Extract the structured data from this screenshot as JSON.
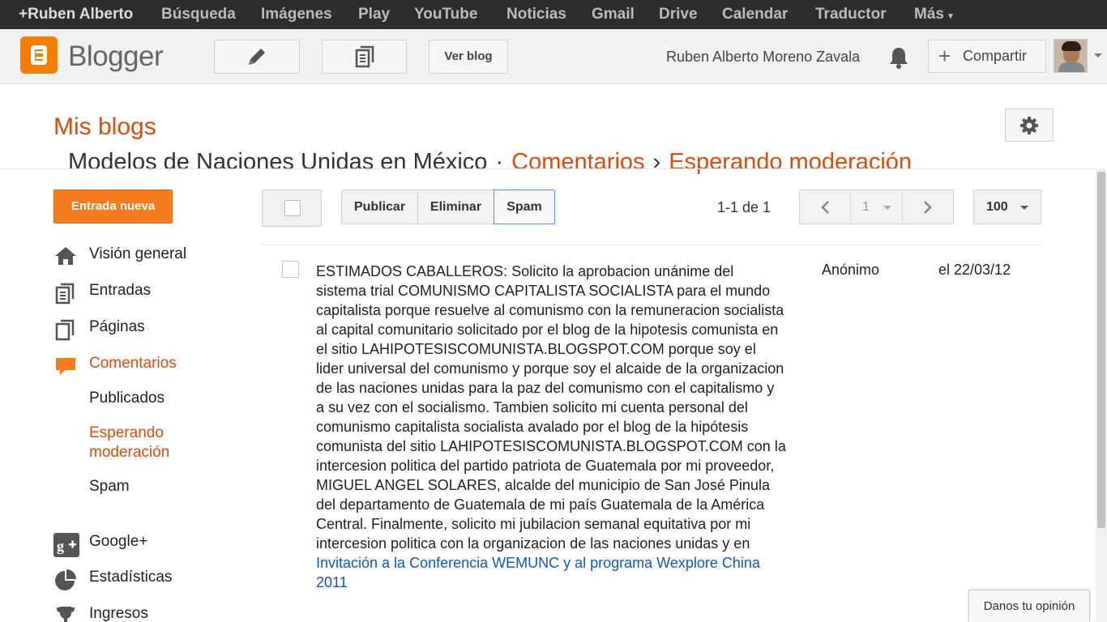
{
  "google_bar": {
    "items": [
      "+Ruben Alberto",
      "Búsqueda",
      "Imágenes",
      "Play",
      "YouTube",
      "Noticias",
      "Gmail",
      "Drive",
      "Calendar",
      "Traductor",
      "Más"
    ]
  },
  "header": {
    "logo_text": "Blogger",
    "view_blog": "Ver blog",
    "user_name": "Ruben Alberto Moreno Zavala",
    "share_label": "Compartir"
  },
  "page": {
    "title": "Mis blogs",
    "breadcrumb": {
      "blog_name": "Modelos de Naciones Unidas en México",
      "dot": "·",
      "section": "Comentarios",
      "arrow": "›",
      "subsection": "Esperando moderación"
    }
  },
  "sidebar": {
    "new_post": "Entrada nueva",
    "items": [
      {
        "label": "Visión general",
        "icon": "home-icon"
      },
      {
        "label": "Entradas",
        "icon": "posts-icon"
      },
      {
        "label": "Páginas",
        "icon": "pages-icon"
      },
      {
        "label": "Comentarios",
        "icon": "comment-icon"
      },
      {
        "label": "Google+",
        "icon": "google-plus-icon"
      },
      {
        "label": "Estadísticas",
        "icon": "pie-chart-icon"
      },
      {
        "label": "Ingresos",
        "icon": "trophy-icon"
      }
    ],
    "comment_subitems": [
      "Publicados",
      "Esperando moderación",
      "Spam"
    ]
  },
  "toolbar": {
    "publish": "Publicar",
    "delete": "Eliminar",
    "spam": "Spam",
    "count": "1-1 de 1",
    "page_number": "1",
    "per_page": "100"
  },
  "comment": {
    "text": "ESTIMADOS CABALLEROS: Solicito la aprobacion unánime del sistema trial COMUNISMO CAPITALISTA SOCIALISTA para el mundo capitalista porque resuelve al comunismo con la remuneracion socialista al capital comunitario solicitado por el blog de la hipotesis comunista en el sitio LAHIPOTESISCOMUNISTA.BLOGSPOT.COM porque soy el lider universal del comunismo y porque soy el alcaide de la organizacion de las naciones unidas para la paz del comunismo con el capitalismo y a su vez con el socialismo. Tambien solicito mi cuenta personal del comunismo capitalista socialista avalado por el blog de la hipótesis comunista del sitio LAHIPOTESISCOMUNISTA.BLOGSPOT.COM con la intercesion politica del partido patriota de Guatemala por mi proveedor, MIGUEL ANGEL SOLARES, alcalde del municipio de San José Pinula del departamento de Guatemala de mi país Guatemala de la América Central. Finalmente, solicito mi jubilacion semanal equitativa por mi intercesion politica con la organizacion de las naciones unidas y en",
    "link": "Invitación a la Conferencia WEMUNC y al programa Wexplore China 2011",
    "author": "Anónimo",
    "date": "el 22/03/12"
  },
  "feedback": "Danos tu opinión",
  "colors": {
    "accent": "#dd4b10",
    "button_orange": "#f57b1f",
    "link": "#1155cc",
    "google_bar": "#2d2d2d"
  }
}
